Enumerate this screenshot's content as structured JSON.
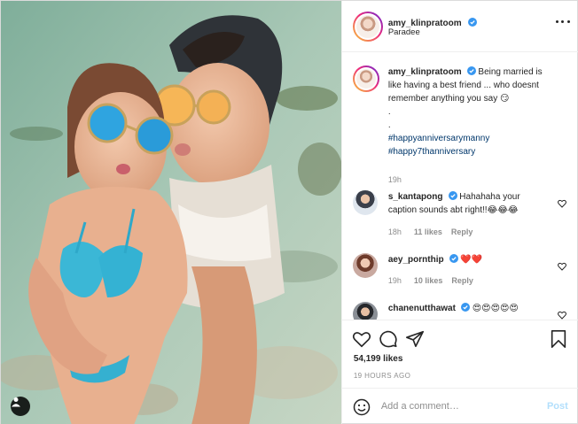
{
  "post": {
    "username": "amy_klinpratoom",
    "location": "Paradee",
    "caption": {
      "username": "amy_klinpratoom",
      "text_lines": [
        "Being married is",
        "like having a best friend ... who doesnt",
        "remember anything you say 😏"
      ],
      "dots": [
        ".",
        "."
      ],
      "hashtags": [
        "#happyanniversarymanny",
        "#happy7thanniversary"
      ],
      "age": "19h"
    },
    "comments": [
      {
        "username": "s_kantapong",
        "text_line1": "Hahahaha your",
        "text_line2": "caption sounds abt right!!😂😂😂",
        "age": "18h",
        "likes": "11 likes",
        "reply": "Reply"
      },
      {
        "username": "aey_pornthip",
        "text_line1": "❤️❤️",
        "age": "19h",
        "likes": "10 likes",
        "reply": "Reply"
      },
      {
        "username": "chanenutthawat",
        "text_line1": "😍😍😍😍😍"
      }
    ],
    "likes_count": "54,199 likes",
    "timestamp": "19 HOURS AGO",
    "add_comment_placeholder": "Add a comment…",
    "post_button": "Post"
  },
  "colors": {
    "verified": "#3897f0",
    "link": "#00376b",
    "muted": "#8e8e8e",
    "post_disabled": "#b2dffc",
    "heart_red": "#ed4956"
  },
  "icons": {
    "like": "heart-icon",
    "comment": "comment-icon",
    "share": "paper-plane-icon",
    "save": "bookmark-icon",
    "more": "more-horizontal-icon",
    "emoji": "smiley-icon",
    "tag": "user-tag-icon"
  }
}
